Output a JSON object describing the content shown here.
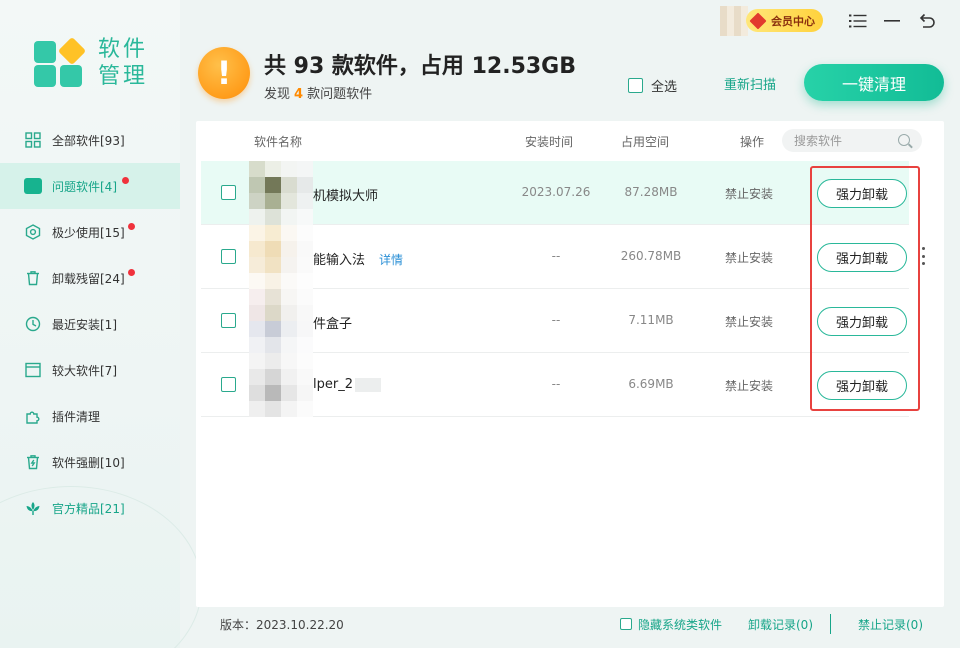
{
  "app": {
    "logo_text": "软件管理",
    "vip_label": "会员中心"
  },
  "sidebar": {
    "items": [
      {
        "label": "全部软件[93]",
        "icon": "grid-icon",
        "dot": false
      },
      {
        "label": "问题软件[4]",
        "icon": "problem-icon",
        "dot": true,
        "active": true
      },
      {
        "label": "极少使用[15]",
        "icon": "hexagon-icon",
        "dot": true
      },
      {
        "label": "卸载残留[24]",
        "icon": "trash-icon",
        "dot": true
      },
      {
        "label": "最近安装[1]",
        "icon": "clock-icon",
        "dot": false
      },
      {
        "label": "较大软件[7]",
        "icon": "window-icon",
        "dot": false
      },
      {
        "label": "插件清理",
        "icon": "puzzle-icon",
        "dot": false
      },
      {
        "label": "软件强删[10]",
        "icon": "force-delete-icon",
        "dot": false
      },
      {
        "label": "官方精品[21]",
        "icon": "lotus-icon",
        "dot": false,
        "featured": true
      }
    ]
  },
  "header": {
    "title": "共 93 款软件，占用 12.53GB",
    "sub_prefix": "发现",
    "sub_count": "4",
    "sub_suffix": "款问题软件",
    "select_all": "全选",
    "rescan": "重新扫描",
    "clean_button": "一键清理"
  },
  "table": {
    "columns": {
      "name": "软件名称",
      "install_time": "安装时间",
      "size": "占用空间",
      "action": "操作"
    },
    "search_placeholder": "搜索软件",
    "rows": [
      {
        "name": "机模拟大师",
        "detail": "",
        "install_time": "2023.07.26",
        "size": "87.28MB",
        "status": "禁止安装",
        "button": "强力卸载"
      },
      {
        "name": "能输入法",
        "detail": "详情",
        "install_time": "--",
        "size": "260.78MB",
        "status": "禁止安装",
        "button": "强力卸载"
      },
      {
        "name": "件盒子",
        "detail": "",
        "install_time": "--",
        "size": "7.11MB",
        "status": "禁止安装",
        "button": "强力卸载"
      },
      {
        "name": "lper_2",
        "detail": "",
        "install_time": "--",
        "size": "6.69MB",
        "status": "禁止安装",
        "button": "强力卸载"
      }
    ]
  },
  "footer": {
    "version": "版本：2023.10.22.20",
    "hide_system": "隐藏系统类软件",
    "uninstall_log": "卸载记录(0)",
    "block_log": "禁止记录(0)"
  },
  "colors": {
    "accent": "#17a589",
    "warning": "#ff9d1b",
    "highlight_border": "#e8423f"
  }
}
